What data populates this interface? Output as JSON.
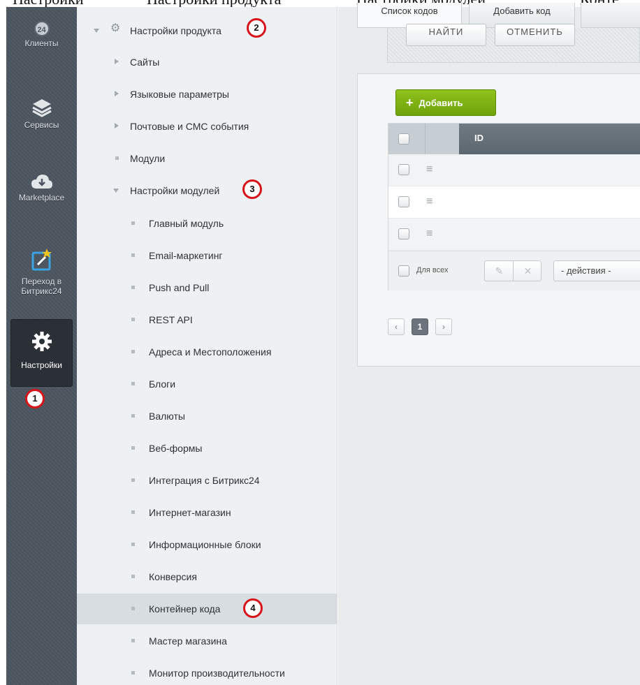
{
  "breadcrumb": [
    "Настройки",
    "Настройки продукта",
    "Настройки модулей",
    "Конте"
  ],
  "leftbar": {
    "items": [
      {
        "label": "Клиенты",
        "badge": "24"
      },
      {
        "label": "Сервисы"
      },
      {
        "label": "Marketplace"
      },
      {
        "label_line1": "Переход в",
        "label_line2": "Битрикс24"
      },
      {
        "label": "Настройки",
        "active": true
      }
    ]
  },
  "tree": {
    "root": "Настройки продукта",
    "items": [
      {
        "label": "Сайты"
      },
      {
        "label": "Языковые параметры"
      },
      {
        "label": "Почтовые и СМС события"
      },
      {
        "label": "Модули"
      },
      {
        "label": "Настройки модулей"
      }
    ],
    "modules": [
      "Главный модуль",
      "Email-маркетинг",
      "Push and Pull",
      "REST API",
      "Адреса и Местоположения",
      "Блоги",
      "Валюты",
      "Веб-формы",
      "Интеграция с Битрикс24",
      "Интернет-магазин",
      "Информационные блоки",
      "Конверсия",
      "Контейнер кода",
      "Мастер магазина",
      "Монитор производительности"
    ],
    "selected": "Контейнер кода"
  },
  "markers": [
    "1",
    "2",
    "3",
    "4"
  ],
  "tabs": [
    "Список кодов",
    "Добавить код"
  ],
  "filter": {
    "find_label": "Найти",
    "cancel_label": "Отменить"
  },
  "grid": {
    "add_label": "Добавить",
    "col_id": "ID",
    "for_all": "Для всех",
    "actions_placeholder": "- действия -"
  },
  "pager": {
    "prev": "‹",
    "page": "1",
    "next": "›"
  },
  "colors": {
    "accent_green": "#7cb50f",
    "marker_red": "#d8131a",
    "sidebar_dark": "#4d5660"
  }
}
